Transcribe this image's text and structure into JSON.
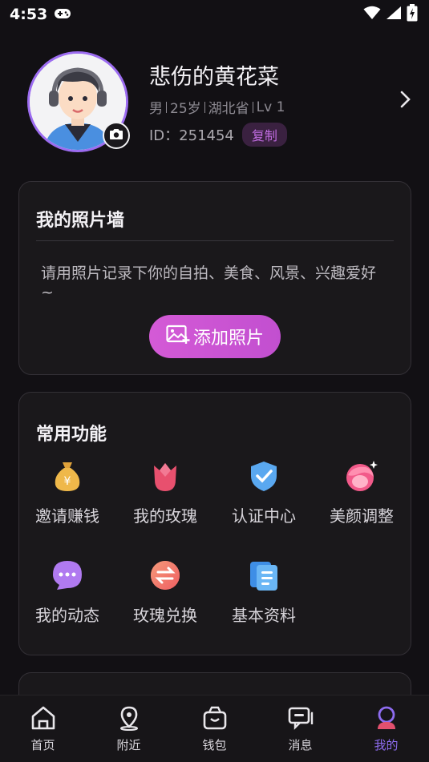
{
  "status_bar": {
    "time": "4:53"
  },
  "profile": {
    "username": "悲伤的黄花菜",
    "gender": "男",
    "age": "25岁",
    "location": "湖北省",
    "level": "Lv 1",
    "id_label": "ID：251454",
    "copy_label": "复制"
  },
  "photo_wall": {
    "title": "我的照片墙",
    "hint": "请用照片记录下你的自拍、美食、风景、兴趣爱好~",
    "add_label": "添加照片"
  },
  "functions": {
    "title": "常用功能",
    "items": [
      {
        "label": "邀请赚钱",
        "icon": "money-bag-icon"
      },
      {
        "label": "我的玫瑰",
        "icon": "rose-icon"
      },
      {
        "label": "认证中心",
        "icon": "shield-check-icon"
      },
      {
        "label": "美颜调整",
        "icon": "beauty-icon"
      },
      {
        "label": "我的动态",
        "icon": "chat-bubble-icon"
      },
      {
        "label": "玫瑰兑换",
        "icon": "exchange-icon"
      },
      {
        "label": "基本资料",
        "icon": "document-icon"
      }
    ]
  },
  "tabs": [
    {
      "label": "首页",
      "icon": "home-icon"
    },
    {
      "label": "附近",
      "icon": "location-icon"
    },
    {
      "label": "钱包",
      "icon": "wallet-icon"
    },
    {
      "label": "消息",
      "icon": "message-icon"
    },
    {
      "label": "我的",
      "icon": "profile-icon",
      "active": true
    }
  ],
  "colors": {
    "accent": "#8e6cf0",
    "button_pink": "#d45ad6",
    "background": "#121014"
  }
}
